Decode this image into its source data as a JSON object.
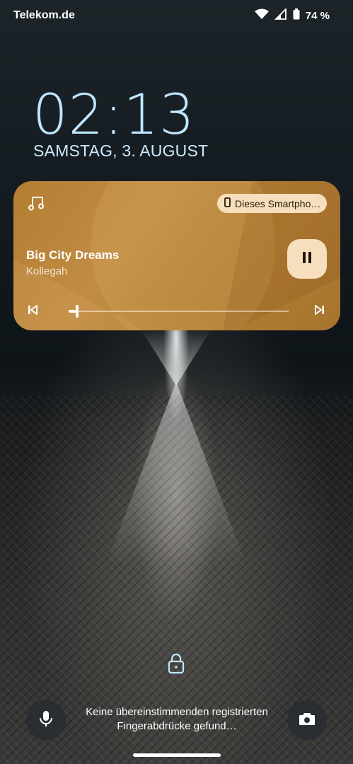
{
  "status_bar": {
    "carrier": "Telekom.de",
    "battery": "74 %",
    "icons": [
      "wifi-icon",
      "signal-icon",
      "battery-icon"
    ]
  },
  "lockscreen": {
    "time": "02:13",
    "date": "SAMSTAG, 3. AUGUST",
    "fingerprint_message": "Keine übereinstimmenden registrierten Fingerabdrücke gefund…"
  },
  "media_player": {
    "output_device": "Dieses Smartpho…",
    "title": "Big City Dreams",
    "artist": "Kollegah",
    "progress": 0.04,
    "accent_color": "#b37d32",
    "chip_color": "#f7dfbd",
    "icons": [
      "music-note-icon",
      "phone-icon",
      "pause-icon",
      "skip-previous-icon",
      "skip-next-icon"
    ]
  },
  "bottom_bar": {
    "icons": [
      "lock-icon",
      "microphone-icon",
      "camera-icon"
    ]
  }
}
